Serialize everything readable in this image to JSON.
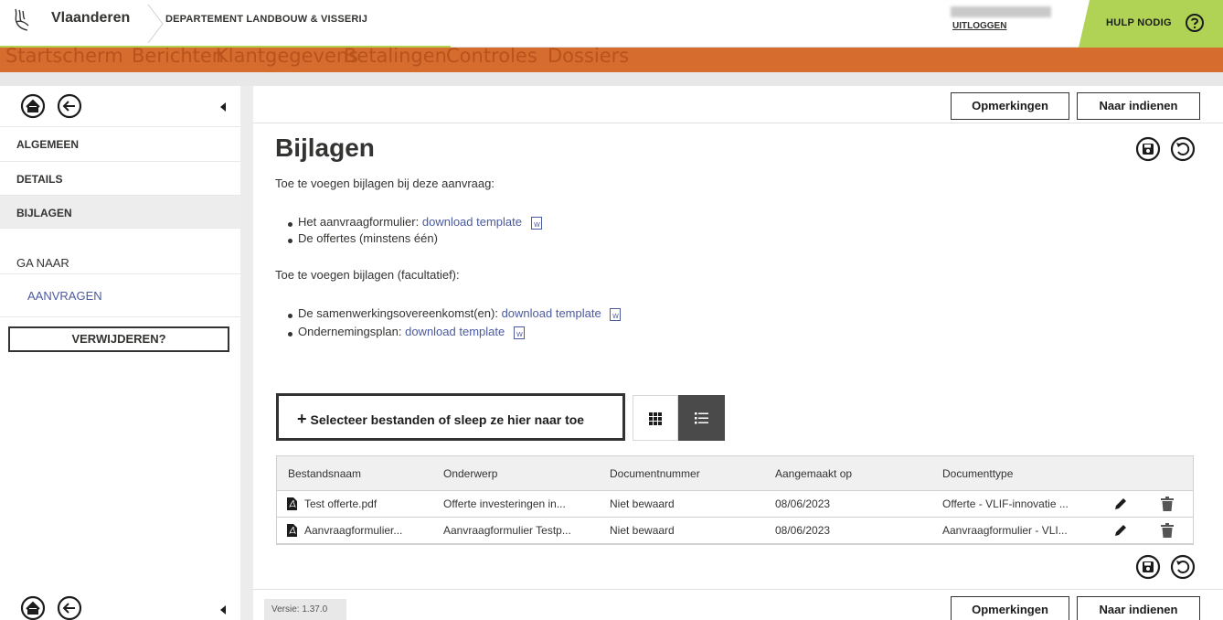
{
  "header": {
    "brand": "Vlaanderen",
    "department": "DEPARTEMENT LANDBOUW & VISSERIJ",
    "logout": "UITLOGGEN",
    "help": "HULP NODIG"
  },
  "topnav": {
    "items": [
      "Startscherm",
      "Berichten",
      "Klantgegevens",
      "Betalingen",
      "Controles",
      "Dossiers"
    ]
  },
  "sidebar": {
    "items": [
      "ALGEMEEN",
      "DETAILS",
      "BIJLAGEN"
    ],
    "goto_label": "GA NAAR",
    "goto_link": "AANVRAGEN",
    "delete_button": "VERWIJDEREN?"
  },
  "actions": {
    "remarks": "Opmerkingen",
    "submit": "Naar indienen"
  },
  "main": {
    "title": "Bijlagen",
    "required_intro": "Toe te voegen bijlagen bij deze aanvraag:",
    "required": [
      {
        "text": "Het aanvraagformulier:",
        "link": "download template"
      },
      {
        "text": "De offertes (minstens één)",
        "link": ""
      }
    ],
    "optional_intro": "Toe te voegen bijlagen (facultatief):",
    "optional": [
      {
        "text": "De samenwerkingsovereenkomst(en):",
        "link": "download template"
      },
      {
        "text": "Ondernemingsplan:",
        "link": "download template"
      }
    ],
    "dropzone": "Selecteer bestanden of sleep ze hier naar toe"
  },
  "table": {
    "columns": [
      "Bestandsnaam",
      "Onderwerp",
      "Documentnummer",
      "Aangemaakt op",
      "Documenttype"
    ],
    "rows": [
      [
        "Test offerte.pdf",
        "Offerte investeringen in...",
        "Niet bewaard",
        "08/06/2023",
        "Offerte - VLIF-innovatie ..."
      ],
      [
        "Aanvraagformulier...",
        "Aanvraagformulier Testp...",
        "Niet bewaard",
        "08/06/2023",
        "Aanvraagformulier - VLI..."
      ]
    ]
  },
  "footer": {
    "version": "Versie: 1.37.0"
  },
  "colors": {
    "accent_orange": "#d66d2f",
    "accent_green": "#b0d356",
    "link": "#4b5a9e"
  }
}
